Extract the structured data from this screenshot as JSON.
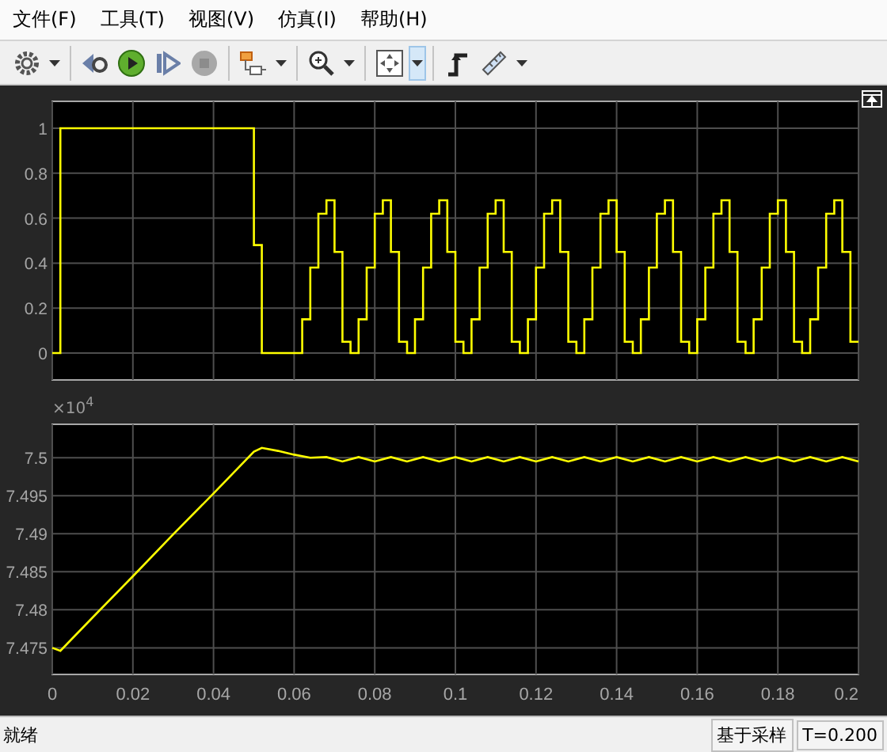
{
  "menu": [
    {
      "label": "文件(F)"
    },
    {
      "label": "工具(T)"
    },
    {
      "label": "视图(V)"
    },
    {
      "label": "仿真(I)"
    },
    {
      "label": "帮助(H)"
    }
  ],
  "toolbar": [
    [
      {
        "kind": "settings",
        "disabled": false
      },
      {
        "kind": "dropdown",
        "active": false
      }
    ],
    [
      {
        "kind": "step-back",
        "disabled": false
      },
      {
        "kind": "run",
        "disabled": false
      },
      {
        "kind": "step-forward",
        "disabled": false
      },
      {
        "kind": "stop",
        "disabled": true
      }
    ],
    [
      {
        "kind": "highlight",
        "disabled": false
      },
      {
        "kind": "dropdown",
        "active": false
      }
    ],
    [
      {
        "kind": "zoom",
        "disabled": false
      },
      {
        "kind": "dropdown",
        "active": false
      }
    ],
    [
      {
        "kind": "fit",
        "disabled": false
      },
      {
        "kind": "dropdown",
        "active": true
      }
    ],
    [
      {
        "kind": "triggers",
        "disabled": false
      },
      {
        "kind": "measure",
        "disabled": false
      },
      {
        "kind": "dropdown",
        "active": false
      }
    ]
  ],
  "plots": [
    {
      "chart_data": {
        "type": "line",
        "grid": true,
        "xlim": [
          0,
          0.2
        ],
        "ylim": [
          -0.12,
          1.12
        ],
        "yticks": [
          0,
          0.2,
          0.4,
          0.6,
          0.8,
          1
        ],
        "x": [
          0,
          0.002,
          0.002,
          0.05,
          0.05,
          0.052,
          0.052,
          0.062,
          0.062,
          0.064,
          0.064,
          0.066,
          0.066,
          0.068,
          0.068,
          0.07,
          0.07,
          0.072,
          0.072,
          0.074,
          0.074,
          0.076,
          0.076,
          0.078,
          0.078,
          0.08,
          0.08,
          0.082,
          0.082,
          0.084,
          0.084,
          0.086,
          0.086,
          0.088,
          0.088,
          0.09,
          0.09,
          0.092,
          0.092,
          0.094,
          0.094,
          0.096,
          0.096,
          0.098,
          0.098,
          0.1,
          0.1,
          0.102,
          0.102,
          0.104,
          0.104,
          0.106,
          0.106,
          0.108,
          0.108,
          0.11,
          0.11,
          0.112,
          0.112,
          0.114,
          0.114,
          0.116,
          0.116,
          0.118,
          0.118,
          0.12,
          0.12,
          0.122,
          0.122,
          0.124,
          0.124,
          0.126,
          0.126,
          0.128,
          0.128,
          0.13,
          0.13,
          0.132,
          0.132,
          0.134,
          0.134,
          0.136,
          0.136,
          0.138,
          0.138,
          0.14,
          0.14,
          0.142,
          0.142,
          0.144,
          0.144,
          0.146,
          0.146,
          0.148,
          0.148,
          0.15,
          0.15,
          0.152,
          0.152,
          0.154,
          0.154,
          0.156,
          0.156,
          0.158,
          0.158,
          0.16,
          0.16,
          0.162,
          0.162,
          0.164,
          0.164,
          0.166,
          0.166,
          0.168,
          0.168,
          0.17,
          0.17,
          0.172,
          0.172,
          0.174,
          0.174,
          0.176,
          0.176,
          0.178,
          0.178,
          0.18,
          0.18,
          0.182,
          0.182,
          0.184,
          0.184,
          0.186,
          0.186,
          0.188,
          0.188,
          0.19,
          0.19,
          0.192,
          0.192,
          0.194,
          0.194,
          0.196,
          0.196,
          0.198,
          0.198,
          0.2
        ],
        "series": [
          {
            "color": "#ffff00",
            "values": [
              0,
              0,
              1,
              1,
              0.48,
              0.48,
              0,
              0,
              0.15,
              0.15,
              0.38,
              0.38,
              0.62,
              0.62,
              0.68,
              0.68,
              0.45,
              0.45,
              0.05,
              0.05,
              0,
              0,
              0.15,
              0.15,
              0.38,
              0.38,
              0.62,
              0.62,
              0.68,
              0.68,
              0.45,
              0.45,
              0.05,
              0.05,
              0,
              0,
              0.15,
              0.15,
              0.38,
              0.38,
              0.62,
              0.62,
              0.68,
              0.68,
              0.45,
              0.45,
              0.05,
              0.05,
              0,
              0,
              0.15,
              0.15,
              0.38,
              0.38,
              0.62,
              0.62,
              0.68,
              0.68,
              0.45,
              0.45,
              0.05,
              0.05,
              0,
              0,
              0.15,
              0.15,
              0.38,
              0.38,
              0.62,
              0.62,
              0.68,
              0.68,
              0.45,
              0.45,
              0.05,
              0.05,
              0,
              0,
              0.15,
              0.15,
              0.38,
              0.38,
              0.62,
              0.62,
              0.68,
              0.68,
              0.45,
              0.45,
              0.05,
              0.05,
              0,
              0,
              0.15,
              0.15,
              0.38,
              0.38,
              0.62,
              0.62,
              0.68,
              0.68,
              0.45,
              0.45,
              0.05,
              0.05,
              0,
              0,
              0.15,
              0.15,
              0.38,
              0.38,
              0.62,
              0.62,
              0.68,
              0.68,
              0.45,
              0.45,
              0.05,
              0.05,
              0,
              0,
              0.15,
              0.15,
              0.38,
              0.38,
              0.62,
              0.62,
              0.68,
              0.68,
              0.45,
              0.45,
              0.05,
              0.05,
              0,
              0,
              0.15,
              0.15,
              0.38,
              0.38,
              0.62,
              0.62,
              0.68,
              0.68,
              0.45,
              0.45,
              0.05,
              0.05
            ]
          }
        ]
      }
    },
    {
      "exponent_label": "×10$^{4}$",
      "chart_data": {
        "type": "line",
        "grid": true,
        "xlim": [
          0,
          0.2
        ],
        "ylim": [
          7.4715,
          7.5044
        ],
        "xticks": [
          0,
          0.02,
          0.04,
          0.06,
          0.08,
          0.1,
          0.12,
          0.14,
          0.16,
          0.18,
          0.2
        ],
        "yticks": [
          7.475,
          7.48,
          7.485,
          7.49,
          7.495,
          7.5
        ],
        "x": [
          0,
          0.002,
          0.01,
          0.02,
          0.03,
          0.04,
          0.05,
          0.052,
          0.056,
          0.06,
          0.064,
          0.068,
          0.072,
          0.076,
          0.08,
          0.084,
          0.088,
          0.092,
          0.096,
          0.1,
          0.104,
          0.108,
          0.112,
          0.116,
          0.12,
          0.124,
          0.128,
          0.132,
          0.136,
          0.14,
          0.144,
          0.148,
          0.152,
          0.156,
          0.16,
          0.164,
          0.168,
          0.172,
          0.176,
          0.18,
          0.184,
          0.188,
          0.192,
          0.196,
          0.2
        ],
        "series": [
          {
            "color": "#ffff00",
            "values": [
              7.475,
              7.4746,
              7.479,
              7.4844,
              7.4899,
              7.4953,
              7.5008,
              7.5013,
              7.5009,
              7.5004,
              7.5,
              7.5001,
              7.4995,
              7.5001,
              7.4995,
              7.5001,
              7.4995,
              7.5001,
              7.4995,
              7.5001,
              7.4995,
              7.5001,
              7.4995,
              7.5001,
              7.4995,
              7.5001,
              7.4995,
              7.5001,
              7.4995,
              7.5001,
              7.4995,
              7.5001,
              7.4995,
              7.5001,
              7.4995,
              7.5001,
              7.4995,
              7.5001,
              7.4995,
              7.5001,
              7.4995,
              7.5001,
              7.4995,
              7.5001,
              7.4995
            ]
          }
        ]
      }
    }
  ],
  "status_bar": {
    "message": "就绪",
    "mode": "基于采样",
    "time": "T=0.200"
  }
}
